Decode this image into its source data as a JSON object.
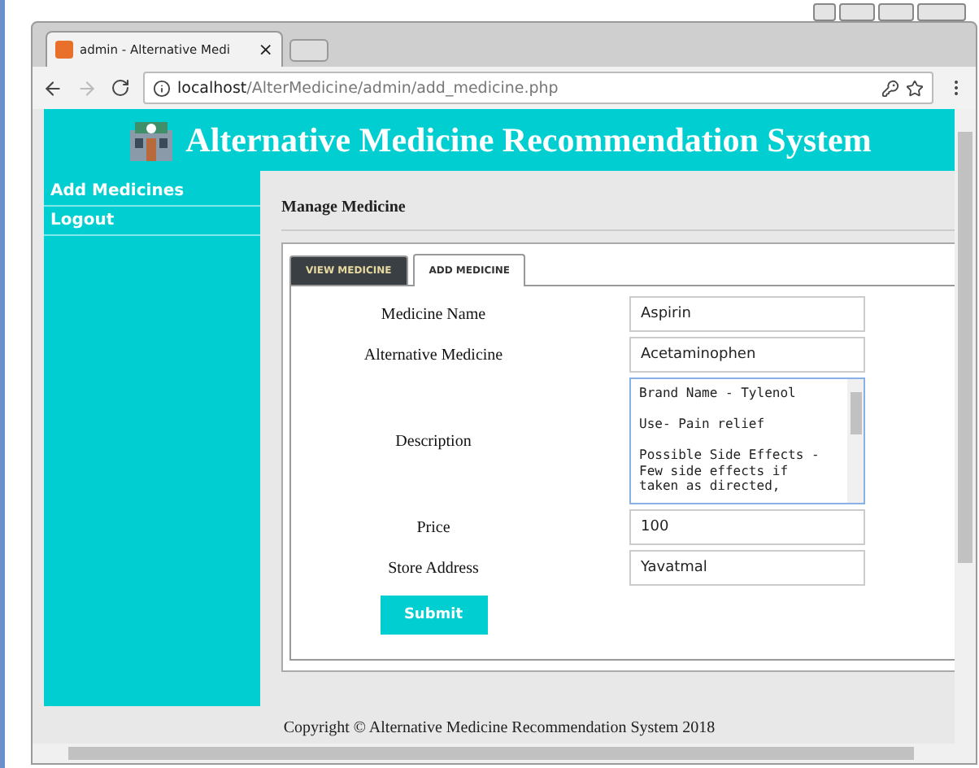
{
  "browser": {
    "tab_title": "admin - Alternative Medi",
    "tab_close": "×",
    "url_host": "localhost",
    "url_path": "/AlterMedicine/admin/add_medicine.php"
  },
  "header": {
    "title": "Alternative Medicine Recommendation System"
  },
  "sidebar": {
    "items": [
      {
        "label": "Add Medicines"
      },
      {
        "label": "Logout"
      }
    ]
  },
  "section_title": "Manage Medicine",
  "tabs": [
    {
      "label": "VIEW MEDICINE",
      "selected": false
    },
    {
      "label": "ADD MEDICINE",
      "selected": true
    }
  ],
  "form": {
    "fields": [
      {
        "label": "Medicine Name",
        "kind": "input",
        "value": "Aspirin"
      },
      {
        "label": "Alternative Medicine",
        "kind": "input",
        "value": "Acetaminophen"
      },
      {
        "label": "Description",
        "kind": "textarea",
        "value": "Brand Name - Tylenol\n\nUse- Pain relief\n\nPossible Side Effects - Few side effects if taken as directed,"
      },
      {
        "label": "Price",
        "kind": "input",
        "value": "100"
      },
      {
        "label": "Store Address",
        "kind": "input",
        "value": "Yavatmal"
      }
    ],
    "submit": "Submit"
  },
  "footer": "Copyright © Alternative Medicine Recommendation System 2018"
}
